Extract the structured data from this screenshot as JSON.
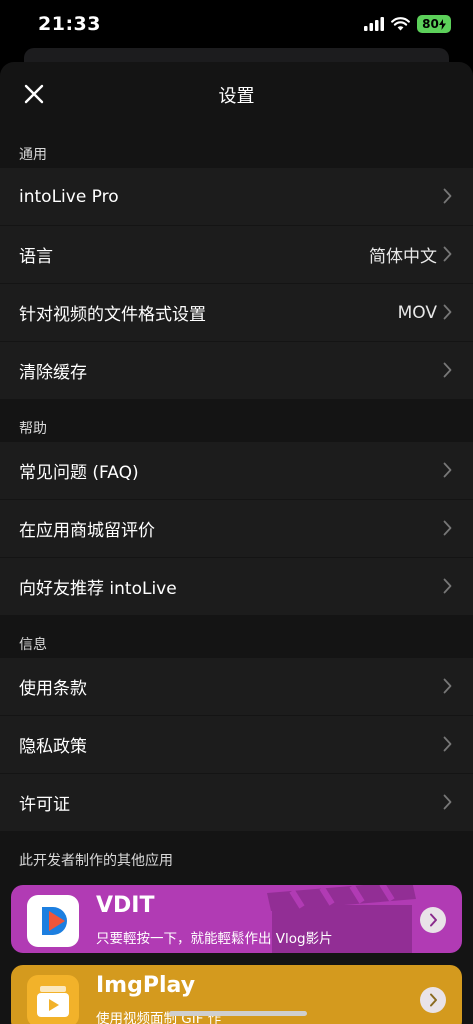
{
  "status": {
    "time": "21:33",
    "battery": "80"
  },
  "header": {
    "title": "设置"
  },
  "sections": [
    {
      "heading": "通用",
      "rows": [
        {
          "label": "intoLive Pro",
          "value": ""
        },
        {
          "label": "语言",
          "value": "简体中文"
        },
        {
          "label": "针对视频的文件格式设置",
          "value": "MOV"
        },
        {
          "label": "清除缓存",
          "value": ""
        }
      ]
    },
    {
      "heading": "帮助",
      "rows": [
        {
          "label": "常见问题 (FAQ)"
        },
        {
          "label": "在应用商城留评价"
        },
        {
          "label": "向好友推荐 intoLive"
        }
      ]
    },
    {
      "heading": "信息",
      "rows": [
        {
          "label": "使用条款"
        },
        {
          "label": "隐私政策"
        },
        {
          "label": "许可证"
        }
      ]
    }
  ],
  "other_apps": {
    "heading": "此开发者制作的其他应用",
    "apps": [
      {
        "title": "VDIT",
        "subtitle": "只要輕按一下，就能輕鬆作出 Vlog影片",
        "color": "#b13bb4"
      },
      {
        "title": "ImgPlay",
        "subtitle": "使用视频面制 GIF 作",
        "color": "#d49a1e"
      }
    ]
  }
}
